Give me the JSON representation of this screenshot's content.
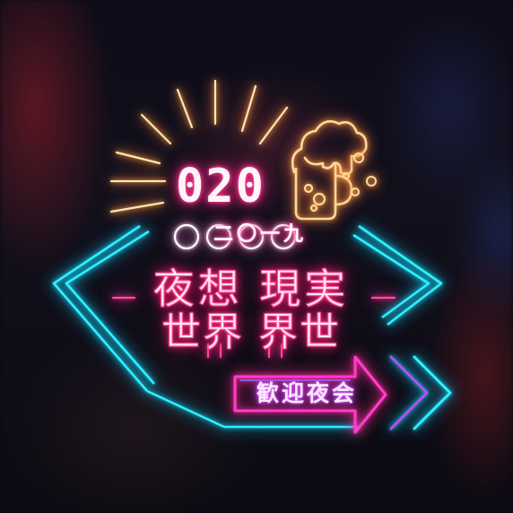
{
  "poster": {
    "year_digits": "020",
    "year_chinese": "二〇一九",
    "title_line1": "夜想 現実",
    "title_line2": "世界 界世",
    "welcome_label": "歓迎夜会"
  },
  "colors": {
    "neon_pink": "#ff2a8a",
    "neon_cyan": "#16e3ff",
    "neon_purple": "#b03cff",
    "neon_warm": "#ffb24a",
    "background": "#0a0a14"
  },
  "icons": [
    "sunburst-icon",
    "beer-mug-icon",
    "bubbles-icon",
    "diamond-frame-icon",
    "arrow-icon",
    "double-chevron-icon"
  ]
}
